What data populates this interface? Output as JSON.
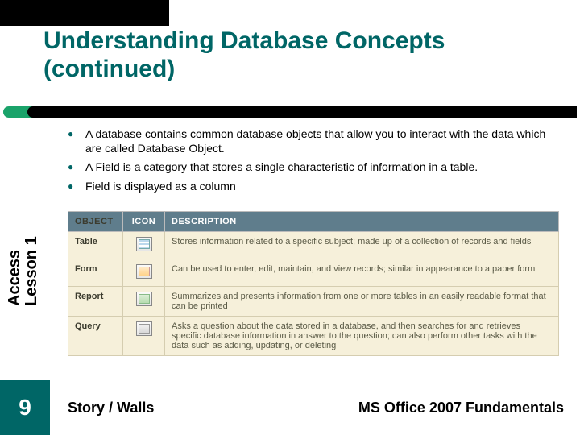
{
  "title": "Understanding Database Concepts (continued)",
  "bullets": [
    "A database contains common database objects that allow you to interact with the data which are called Database Object.",
    "A Field is a category that stores a single characteristic of information in a table.",
    "Field is displayed as a column"
  ],
  "side_label": "Access\nLesson 1",
  "table": {
    "headers": {
      "object": "OBJECT",
      "icon": "ICON",
      "description": "DESCRIPTION"
    },
    "rows": [
      {
        "object": "Table",
        "icon": "table-icon",
        "description": "Stores information related to a specific subject; made up of a collection of records and fields"
      },
      {
        "object": "Form",
        "icon": "form-icon",
        "description": "Can be used to enter, edit, maintain, and view records; similar in appearance to a paper form"
      },
      {
        "object": "Report",
        "icon": "report-icon",
        "description": "Summarizes and presents information from one or more tables in an easily readable format that can be printed"
      },
      {
        "object": "Query",
        "icon": "query-icon",
        "description": "Asks a question about the data stored in a database, and then searches for and retrieves specific database information in answer to the question; can also perform other tasks with the data such as adding, updating, or deleting"
      }
    ]
  },
  "slide_number": "9",
  "footer": {
    "left": "Story / Walls",
    "right": "MS Office 2007 Fundamentals"
  }
}
